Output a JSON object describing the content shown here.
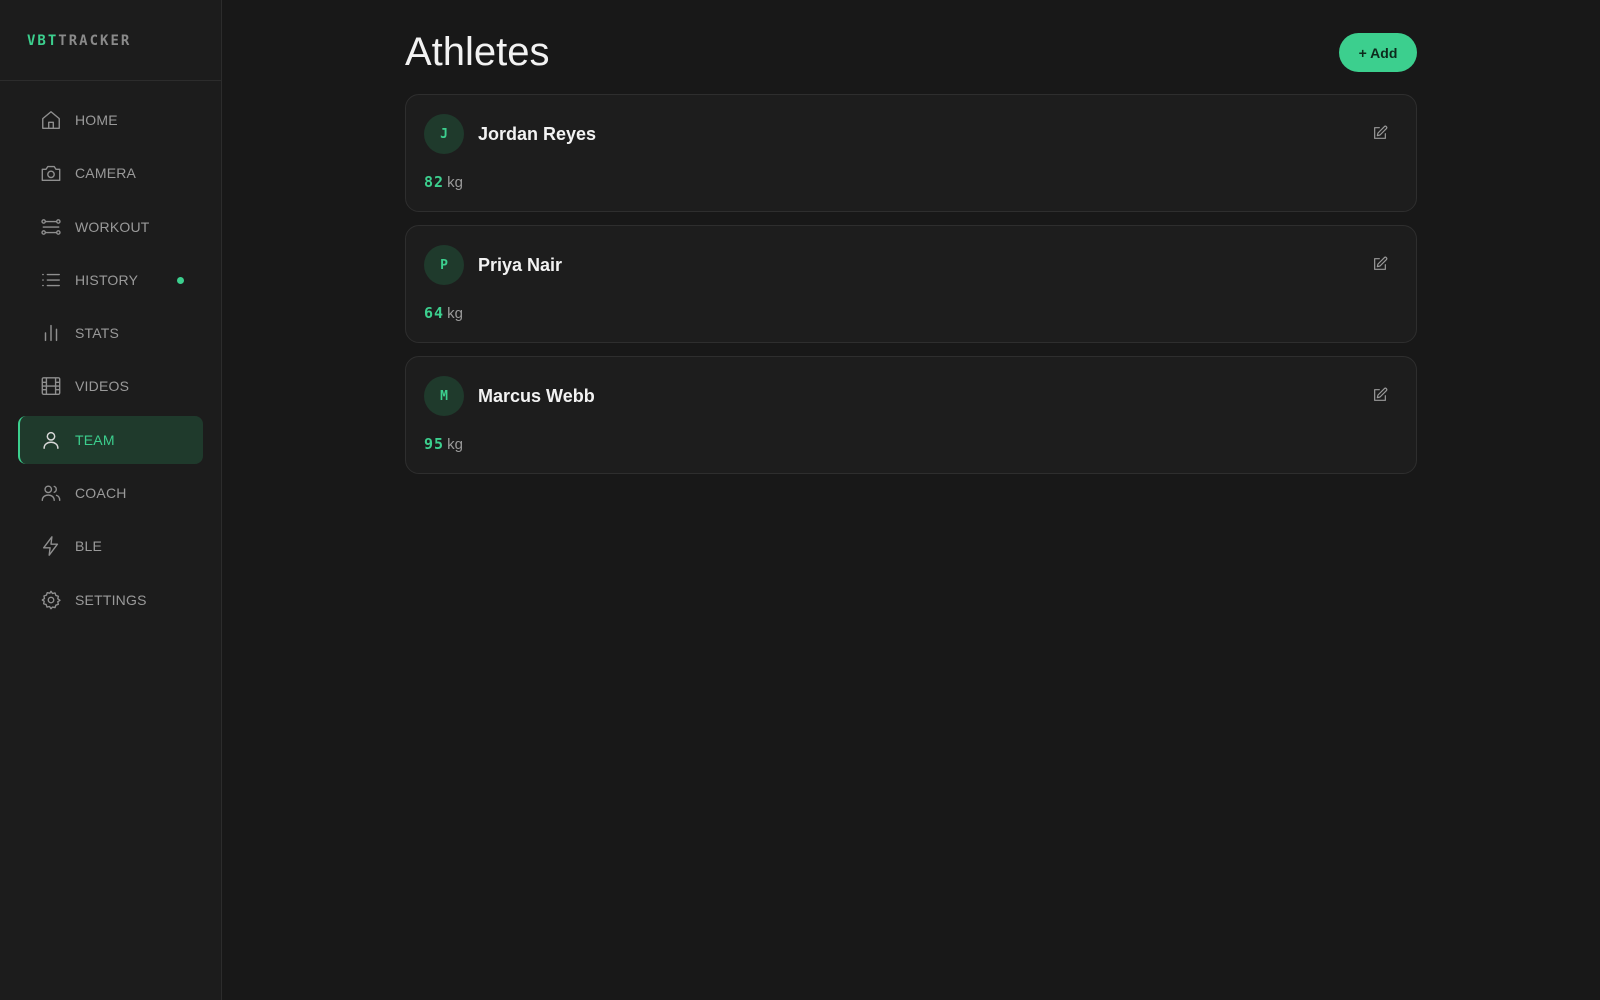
{
  "brand": {
    "part1": "VBT",
    "part2": "TRACKER"
  },
  "colors": {
    "accent": "#3ccf8e",
    "background": "#181818",
    "sidebar": "#1c1c1c",
    "active_bg": "#1f3a2c"
  },
  "sidebar": {
    "items": [
      {
        "label": "HOME",
        "icon": "home-icon"
      },
      {
        "label": "CAMERA",
        "icon": "camera-icon"
      },
      {
        "label": "WORKOUT",
        "icon": "workout-icon"
      },
      {
        "label": "HISTORY",
        "icon": "list-icon",
        "indicator": true
      },
      {
        "label": "STATS",
        "icon": "bar-chart-icon"
      },
      {
        "label": "VIDEOS",
        "icon": "film-icon"
      },
      {
        "label": "TEAM",
        "icon": "user-icon",
        "active": true
      },
      {
        "label": "COACH",
        "icon": "users-icon"
      },
      {
        "label": "BLE",
        "icon": "lightning-icon"
      },
      {
        "label": "SETTINGS",
        "icon": "gear-icon"
      }
    ]
  },
  "main": {
    "title": "Athletes",
    "add_label": "+ Add",
    "athletes": [
      {
        "initial": "J",
        "name": "Jordan Reyes",
        "weight": "82",
        "unit": "kg"
      },
      {
        "initial": "P",
        "name": "Priya Nair",
        "weight": "64",
        "unit": "kg"
      },
      {
        "initial": "M",
        "name": "Marcus Webb",
        "weight": "95",
        "unit": "kg"
      }
    ]
  }
}
